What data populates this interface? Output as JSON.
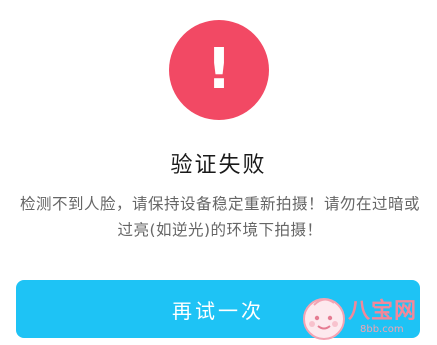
{
  "alert": {
    "symbol": "!",
    "color": "#f24964"
  },
  "dialog": {
    "title": "验证失败",
    "message": "检测不到人脸，请保持设备稳定重新拍摄！请勿在过暗或过亮(如逆光)的环境下拍摄！"
  },
  "retry_button": {
    "label": "再试一次",
    "color": "#1ec3f5"
  },
  "watermark": {
    "logo_text": "八宝网",
    "url": "8bb.com"
  }
}
